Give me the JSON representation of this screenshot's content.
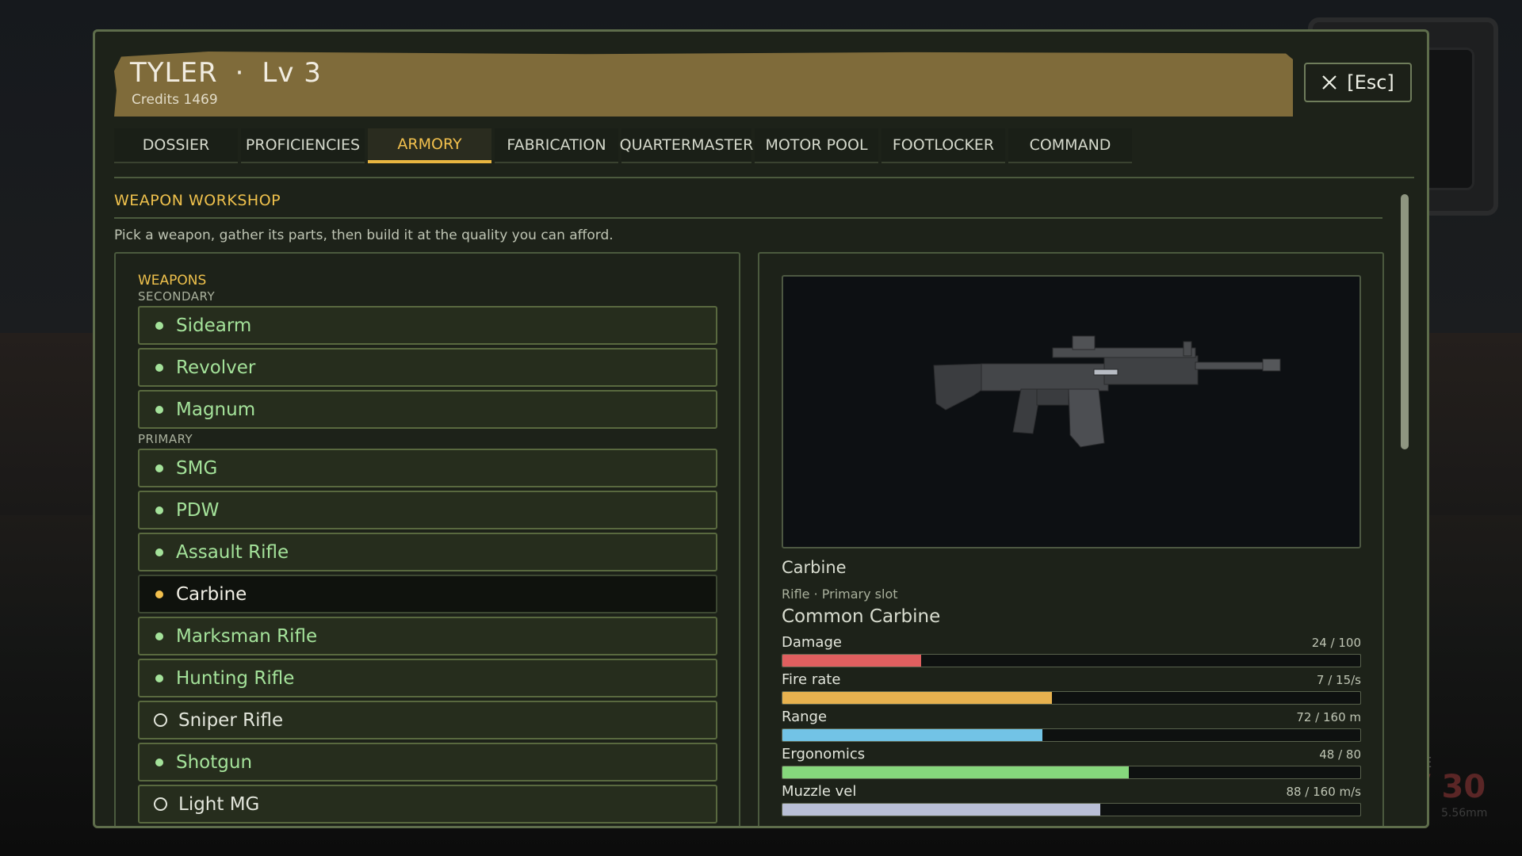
{
  "player": {
    "name": "TYLER",
    "separator": "·",
    "level": "Lv 3",
    "credits": "Credits 1469"
  },
  "close": {
    "label": "[Esc]",
    "icon": "close-icon"
  },
  "tabs": [
    {
      "label": "DOSSIER",
      "active": false
    },
    {
      "label": "PROFICIENCIES",
      "active": false
    },
    {
      "label": "ARMORY",
      "active": true
    },
    {
      "label": "FABRICATION",
      "active": false
    },
    {
      "label": "QUARTERMASTER",
      "active": false
    },
    {
      "label": "MOTOR POOL",
      "active": false
    },
    {
      "label": "FOOTLOCKER",
      "active": false
    },
    {
      "label": "COMMAND",
      "active": false
    }
  ],
  "workshop": {
    "title": "WEAPON WORKSHOP",
    "description": "Pick a weapon, gather its parts, then build it at the quality you can afford."
  },
  "weapons": {
    "title": "WEAPONS",
    "secondary_label": "SECONDARY",
    "primary_label": "PRIMARY",
    "secondary": [
      {
        "label": "Sidearm",
        "state": "unlocked"
      },
      {
        "label": "Revolver",
        "state": "unlocked"
      },
      {
        "label": "Magnum",
        "state": "unlocked"
      }
    ],
    "primary": [
      {
        "label": "SMG",
        "state": "unlocked"
      },
      {
        "label": "PDW",
        "state": "unlocked"
      },
      {
        "label": "Assault Rifle",
        "state": "unlocked"
      },
      {
        "label": "Carbine",
        "state": "selected"
      },
      {
        "label": "Marksman Rifle",
        "state": "unlocked"
      },
      {
        "label": "Hunting Rifle",
        "state": "unlocked"
      },
      {
        "label": "Sniper Rifle",
        "state": "locked"
      },
      {
        "label": "Shotgun",
        "state": "unlocked"
      },
      {
        "label": "Light MG",
        "state": "locked"
      }
    ]
  },
  "detail": {
    "name": "Carbine",
    "subtitle": "Rifle · Primary slot",
    "variant": "Common Carbine",
    "stats": [
      {
        "label": "Damage",
        "value": "24 / 100",
        "fraction": 0.24,
        "color": "#e05f5f"
      },
      {
        "label": "Fire rate",
        "value": "7 / 15/s",
        "fraction": 0.467,
        "color": "#e7b24f"
      },
      {
        "label": "Range",
        "value": "72 / 160 m",
        "fraction": 0.45,
        "color": "#72c3e6"
      },
      {
        "label": "Ergonomics",
        "value": "48 / 80",
        "fraction": 0.6,
        "color": "#86d77c"
      },
      {
        "label": "Muzzle vel",
        "value": "88 / 160 m/s",
        "fraction": 0.55,
        "color": "#b9bfd6"
      }
    ]
  },
  "hud": {
    "ammo": "/ 30",
    "caliber": "5.56mm",
    "letter": "E"
  }
}
